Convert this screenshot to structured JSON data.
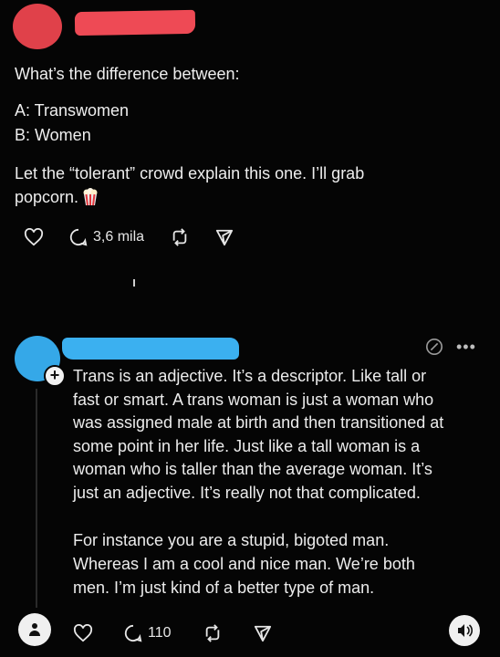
{
  "post": {
    "line_1": "What’s the difference between:",
    "line_2": "A: Transwomen",
    "line_3": "B: Women",
    "line_4": "Let the “tolerant” crowd explain this one. I’ll grab",
    "line_5": "popcorn.",
    "reply_count": "3,6 mila"
  },
  "reply": {
    "p1_lines": [
      "Trans is an adjective. It’s a descriptor. Like tall or",
      "fast or smart. A trans woman is just a woman who",
      "was assigned male at birth and then transitioned at",
      "some point in her life. Just like a tall woman is a",
      "woman who is taller than the average woman. It’s",
      "just an adjective. It’s really not that complicated."
    ],
    "p2_lines": [
      "For instance you are a stupid, bigoted man.",
      "Whereas I am a cool and nice man. We’re both",
      "men. I’m just kind of a better type of man."
    ],
    "reply_count": "110",
    "more_label": "•••"
  },
  "colors": {
    "background": "#050505",
    "redaction_red": "#ee4a55",
    "redaction_blue": "#3bb0f0"
  },
  "icons": [
    "heart-icon",
    "comment-icon",
    "repost-icon",
    "share-icon",
    "popcorn-emoji-icon",
    "edit-icon",
    "more-icon",
    "speaker-icon",
    "person-icon"
  ]
}
